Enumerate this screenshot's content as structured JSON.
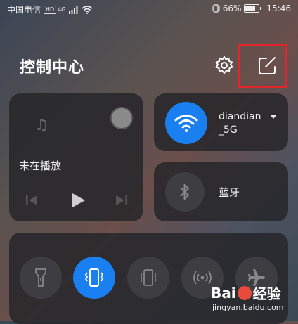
{
  "status_bar": {
    "carrier": "中国电信",
    "hd": "HD",
    "net": "4G",
    "battery": "66%",
    "time": "15:46"
  },
  "header": {
    "title": "控制中心",
    "settings_icon": "gear-icon",
    "edit_icon": "edit-icon"
  },
  "highlight_color": "#e0262b",
  "accent_color": "#1a7ff0",
  "media": {
    "status": "未在播放"
  },
  "wifi": {
    "ssid_line1": "diandian",
    "ssid_line2": "_5G"
  },
  "bluetooth": {
    "label": "蓝牙"
  },
  "toggles": [
    {
      "name": "flashlight",
      "active": false
    },
    {
      "name": "vibrate",
      "active": true
    },
    {
      "name": "auto-rotate",
      "active": false
    },
    {
      "name": "hotspot",
      "active": false
    },
    {
      "name": "airplane-mode",
      "active": false
    }
  ],
  "watermark": {
    "brand_a": "Bai",
    "brand_b": "经验",
    "site": "jingyan.baidu.com"
  }
}
